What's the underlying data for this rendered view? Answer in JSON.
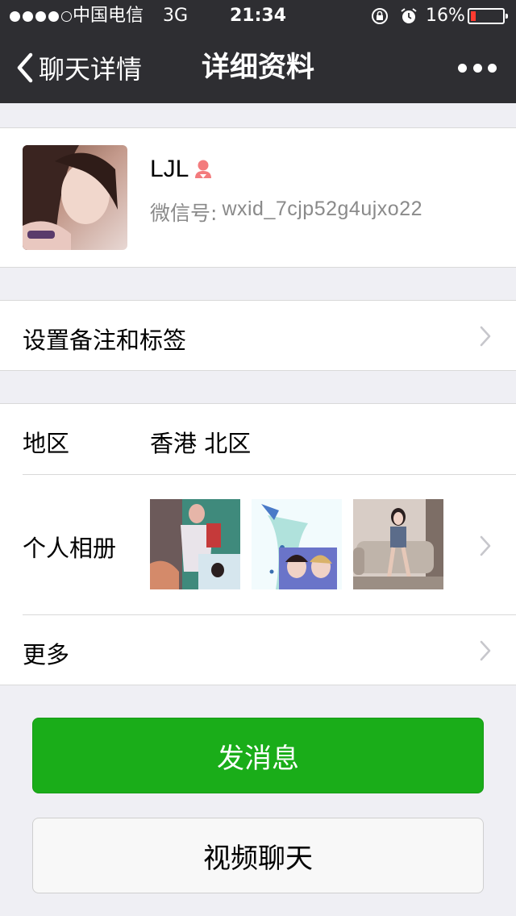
{
  "status_bar": {
    "carrier": "中国电信",
    "network": "3G",
    "time": "21:34",
    "battery": "16%",
    "battery_level": 0.16,
    "signal_bars": 4
  },
  "nav": {
    "back_label": "聊天详情",
    "title": "详细资料"
  },
  "profile": {
    "name": "LJL",
    "wxid_label": "微信号:",
    "wxid": "wxid_7cjp52g4ujxo22",
    "gender_icon": "female-icon"
  },
  "remark": {
    "label": "设置备注和标签"
  },
  "info": {
    "region_label": "地区",
    "region_value": "香港 北区",
    "album_label": "个人相册",
    "more_label": "更多"
  },
  "actions": {
    "message": "发消息",
    "video_call": "视频聊天"
  },
  "colors": {
    "nav_bg": "#2e2e32",
    "page_bg": "#efeff4",
    "primary_button": "#1aad19",
    "female_icon": "#f37b7d",
    "battery_low": "#ff3b30"
  }
}
